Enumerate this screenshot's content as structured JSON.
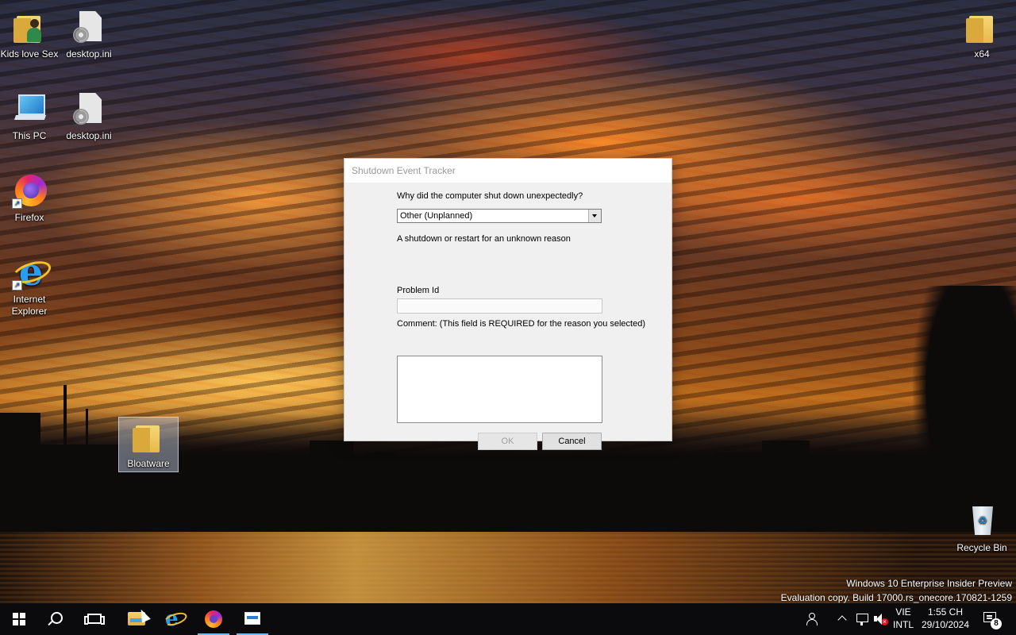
{
  "desktop": {
    "icons": [
      {
        "label": "Kids love Sex",
        "icon": "folder-user-icon"
      },
      {
        "label": "desktop.ini",
        "icon": "settings-file-icon"
      },
      {
        "label": "This PC",
        "icon": "computer-icon"
      },
      {
        "label": "desktop.ini",
        "icon": "settings-file-icon"
      },
      {
        "label": "Firefox",
        "icon": "firefox-icon"
      },
      {
        "label": "Internet Explorer",
        "icon": "internet-explorer-icon"
      },
      {
        "label": "Bloatware",
        "icon": "folder-icon",
        "selected": true
      },
      {
        "label": "x64",
        "icon": "folder-icon"
      },
      {
        "label": "Recycle Bin",
        "icon": "recycle-bin-icon"
      }
    ]
  },
  "dialog": {
    "title": "Shutdown Event Tracker",
    "question": "Why did the computer shut down unexpectedly?",
    "reason_selected": "Other (Unplanned)",
    "reason_description": "A shutdown or restart for an unknown reason",
    "problem_id_label": "Problem Id",
    "problem_id_value": "",
    "comment_label": "Comment: (This field is REQUIRED for the reason you selected)",
    "comment_value": "",
    "ok_label": "OK",
    "cancel_label": "Cancel"
  },
  "watermark": {
    "line1": "Windows 10 Enterprise Insider Preview",
    "line2": "Evaluation copy. Build 17000.rs_onecore.170821-1259"
  },
  "taskbar": {
    "pinned": [
      "start-button",
      "search-button",
      "task-view-button",
      "file-explorer",
      "internet-explorer",
      "firefox",
      "shutdown-event-tracker"
    ],
    "tray": {
      "language_line1": "VIE",
      "language_line2": "INTL",
      "time": "1:55 CH",
      "date": "29/10/2024",
      "notification_count": "8"
    }
  }
}
